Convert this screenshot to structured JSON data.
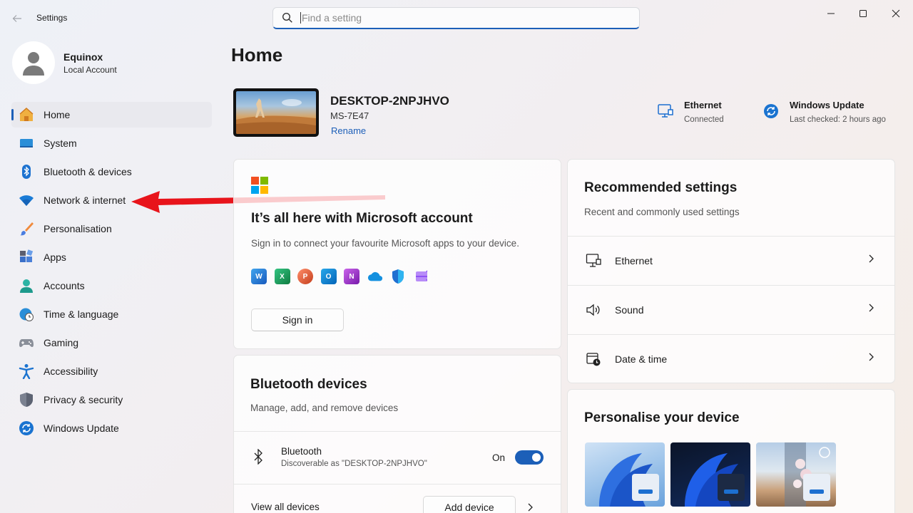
{
  "window": {
    "app_title": "Settings",
    "search_placeholder": "Find a setting"
  },
  "profile": {
    "name": "Equinox",
    "account_type": "Local Account"
  },
  "sidebar": {
    "items": [
      {
        "label": "Home",
        "icon": "home-icon",
        "active": true
      },
      {
        "label": "System",
        "icon": "system-icon"
      },
      {
        "label": "Bluetooth & devices",
        "icon": "bluetooth-icon"
      },
      {
        "label": "Network & internet",
        "icon": "wifi-icon"
      },
      {
        "label": "Personalisation",
        "icon": "brush-icon"
      },
      {
        "label": "Apps",
        "icon": "apps-icon"
      },
      {
        "label": "Accounts",
        "icon": "accounts-icon"
      },
      {
        "label": "Time & language",
        "icon": "globe-clock-icon"
      },
      {
        "label": "Gaming",
        "icon": "gamepad-icon"
      },
      {
        "label": "Accessibility",
        "icon": "accessibility-icon"
      },
      {
        "label": "Privacy & security",
        "icon": "shield-icon"
      },
      {
        "label": "Windows Update",
        "icon": "update-icon"
      }
    ]
  },
  "main": {
    "title": "Home",
    "device": {
      "name": "DESKTOP-2NPJHVO",
      "model": "MS-7E47",
      "rename_label": "Rename"
    },
    "status": {
      "ethernet": {
        "title": "Ethernet",
        "subtitle": "Connected"
      },
      "update": {
        "title": "Windows Update",
        "subtitle": "Last checked: 2 hours ago"
      }
    },
    "ms_account": {
      "title": "It’s all here with Microsoft account",
      "subtitle": "Sign in to connect your favourite Microsoft apps to your device.",
      "app_icons": [
        "word-icon",
        "excel-icon",
        "powerpoint-icon",
        "outlook-icon",
        "onenote-icon",
        "onedrive-icon",
        "defender-icon",
        "clipchamp-icon"
      ],
      "sign_in_label": "Sign in"
    },
    "bluetooth": {
      "title": "Bluetooth devices",
      "subtitle": "Manage, add, and remove devices",
      "device_label": "Bluetooth",
      "device_status": "Discoverable as \"DESKTOP-2NPJHVO\"",
      "toggle_label": "On",
      "toggle_on": true,
      "view_all_label": "View all devices",
      "add_device_label": "Add device"
    },
    "recommended": {
      "title": "Recommended settings",
      "subtitle": "Recent and commonly used settings",
      "items": [
        {
          "label": "Ethernet",
          "icon": "ethernet-icon"
        },
        {
          "label": "Sound",
          "icon": "speaker-icon"
        },
        {
          "label": "Date & time",
          "icon": "calendar-clock-icon"
        }
      ]
    },
    "personalise": {
      "title": "Personalise your device"
    }
  },
  "colors": {
    "accent": "#1c5fb8",
    "annotation_arrow": "#e8141b"
  }
}
